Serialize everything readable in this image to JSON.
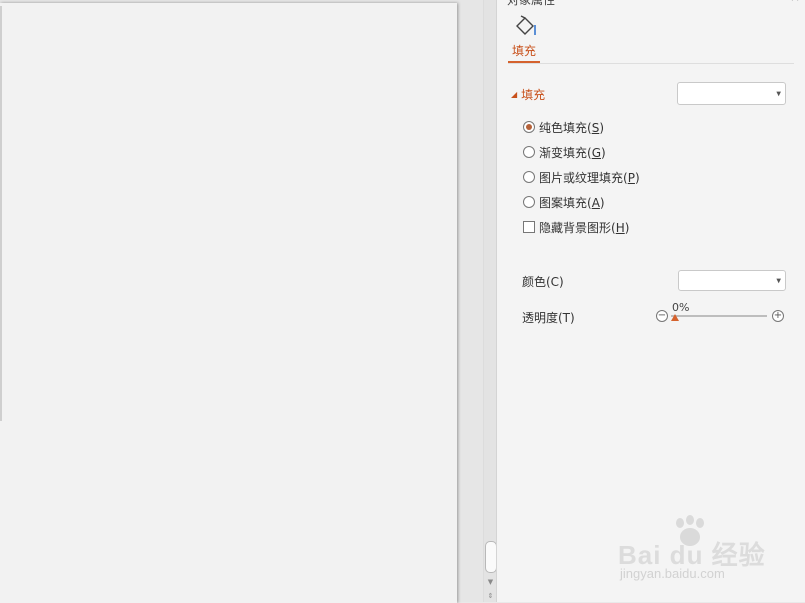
{
  "panel": {
    "title": "对象属性",
    "close": "×",
    "tab": {
      "label": "填充",
      "icon": "paint-bucket-icon"
    },
    "section": {
      "label": "填充",
      "dropdown_value": ""
    },
    "options": [
      {
        "label": "纯色填充(",
        "key": "S",
        "suffix": ")",
        "type": "radio",
        "selected": true
      },
      {
        "label": "渐变填充(",
        "key": "G",
        "suffix": ")",
        "type": "radio",
        "selected": false
      },
      {
        "label": "图片或纹理填充(",
        "key": "P",
        "suffix": ")",
        "type": "radio",
        "selected": false
      },
      {
        "label": "图案填充(",
        "key": "A",
        "suffix": ")",
        "type": "radio",
        "selected": false
      },
      {
        "label": "隐藏背景图形(",
        "key": "H",
        "suffix": ")",
        "type": "checkbox",
        "selected": false
      }
    ],
    "color": {
      "label": "颜色(C)",
      "value": ""
    },
    "transparency": {
      "label": "透明度(T)",
      "value": "0%",
      "percent": 0,
      "minus": "−",
      "plus": "+"
    }
  },
  "scrollbar": {
    "down_arrow": "▼",
    "double_arrow": "⇕"
  },
  "watermark": {
    "text": "Bai du 经验",
    "url": "jingyan.baidu.com"
  },
  "colors": {
    "accent": "#d5622d",
    "accent_text": "#c8511b",
    "page": "#f2f2f2",
    "panel": "#f4f4f4"
  }
}
